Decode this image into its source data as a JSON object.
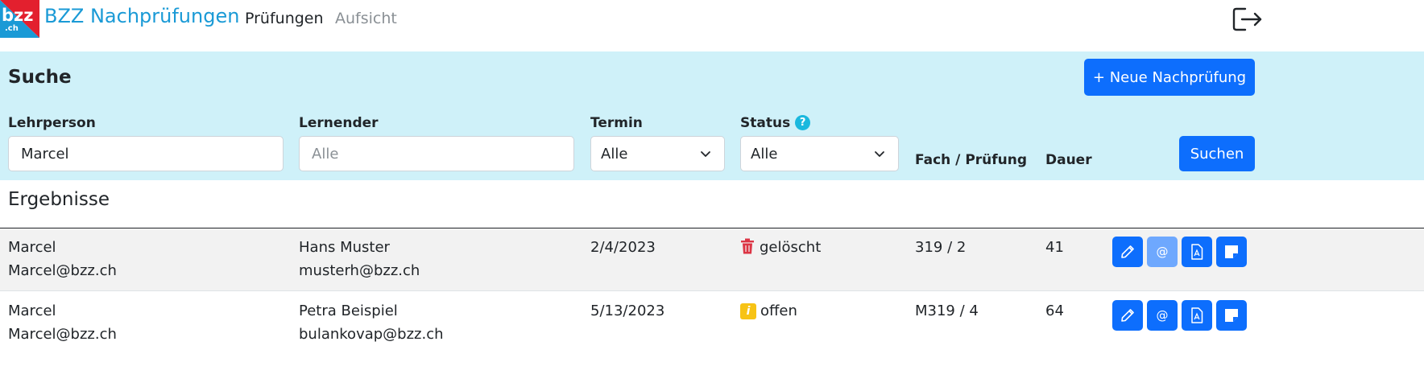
{
  "navbar": {
    "logo_text": "bzz",
    "logo_sub": ".ch",
    "brand": "BZZ Nachprüfungen",
    "links": [
      {
        "label": "Prüfungen",
        "active": true
      },
      {
        "label": "Aufsicht",
        "active": false
      }
    ],
    "logout_icon": "logout-icon"
  },
  "search": {
    "title": "Suche",
    "new_button": "+ Neue Nachprüfung",
    "fields": {
      "teacher": {
        "label": "Lehrperson",
        "value": "Marcel"
      },
      "student": {
        "label": "Lernender",
        "placeholder": "Alle"
      },
      "date": {
        "label": "Termin",
        "selected": "Alle"
      },
      "status": {
        "label": "Status",
        "selected": "Alle",
        "help": "?"
      }
    },
    "column_headers": {
      "subject": "Fach / Prüfung",
      "duration": "Dauer"
    },
    "search_button": "Suchen"
  },
  "results": {
    "title": "Ergebnisse",
    "rows": [
      {
        "teacher_name": "Marcel",
        "teacher_email": "Marcel@bzz.ch",
        "student_name": "Hans Muster",
        "student_email": "musterh@bzz.ch",
        "date": "2/4/2023",
        "status": "gelöscht",
        "status_icon": "trash-icon",
        "subject": "319 / 2",
        "duration": "41",
        "email_disabled": true
      },
      {
        "teacher_name": "Marcel",
        "teacher_email": "Marcel@bzz.ch",
        "student_name": "Petra Beispiel",
        "student_email": "bulankovap@bzz.ch",
        "date": "5/13/2023",
        "status": "offen",
        "status_icon": "info-icon",
        "subject": "M319 / 4",
        "duration": "64",
        "email_disabled": false
      }
    ],
    "action_icons": [
      "edit-icon",
      "email-icon",
      "pdf-icon",
      "note-icon"
    ]
  },
  "colors": {
    "primary": "#0d6efd",
    "primary_disabled": "#6ea8fe",
    "search_bg": "#cff1f9",
    "brand": "#1a9ad6",
    "logo_red": "#e3202e",
    "danger": "#dc3545",
    "warning": "#f7c315"
  }
}
